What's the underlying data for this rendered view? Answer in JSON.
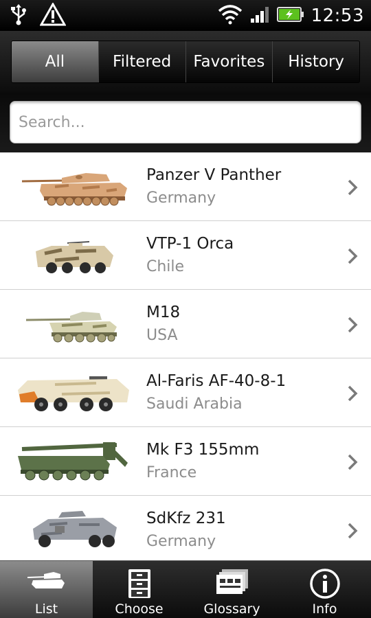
{
  "status_bar": {
    "time": "12:53",
    "icons": [
      "usb-icon",
      "warning-icon",
      "wifi-icon",
      "signal-icon",
      "battery-charging-icon"
    ],
    "battery_color": "#5cc11e"
  },
  "tabs": [
    {
      "label": "All",
      "active": true
    },
    {
      "label": "Filtered",
      "active": false
    },
    {
      "label": "Favorites",
      "active": false
    },
    {
      "label": "History",
      "active": false
    }
  ],
  "search": {
    "placeholder": "Search...",
    "value": ""
  },
  "vehicles": [
    {
      "name": "Panzer V Panther",
      "country": "Germany",
      "icon": "tank-thumbnail"
    },
    {
      "name": "VTP-1 Orca",
      "country": "Chile",
      "icon": "apc-thumbnail"
    },
    {
      "name": "M18",
      "country": "USA",
      "icon": "tank-destroyer-thumbnail"
    },
    {
      "name": "Al-Faris AF-40-8-1",
      "country": "Saudi Arabia",
      "icon": "apc-thumbnail"
    },
    {
      "name": "Mk F3 155mm",
      "country": "France",
      "icon": "self-propelled-gun-thumbnail"
    },
    {
      "name": "SdKfz 231",
      "country": "Germany",
      "icon": "armored-car-thumbnail"
    }
  ],
  "bottom_nav": [
    {
      "label": "List",
      "icon": "tank-icon",
      "active": true
    },
    {
      "label": "Choose",
      "icon": "filing-cabinet-icon",
      "active": false
    },
    {
      "label": "Glossary",
      "icon": "cards-icon",
      "active": false
    },
    {
      "label": "Info",
      "icon": "info-icon",
      "active": false
    }
  ]
}
